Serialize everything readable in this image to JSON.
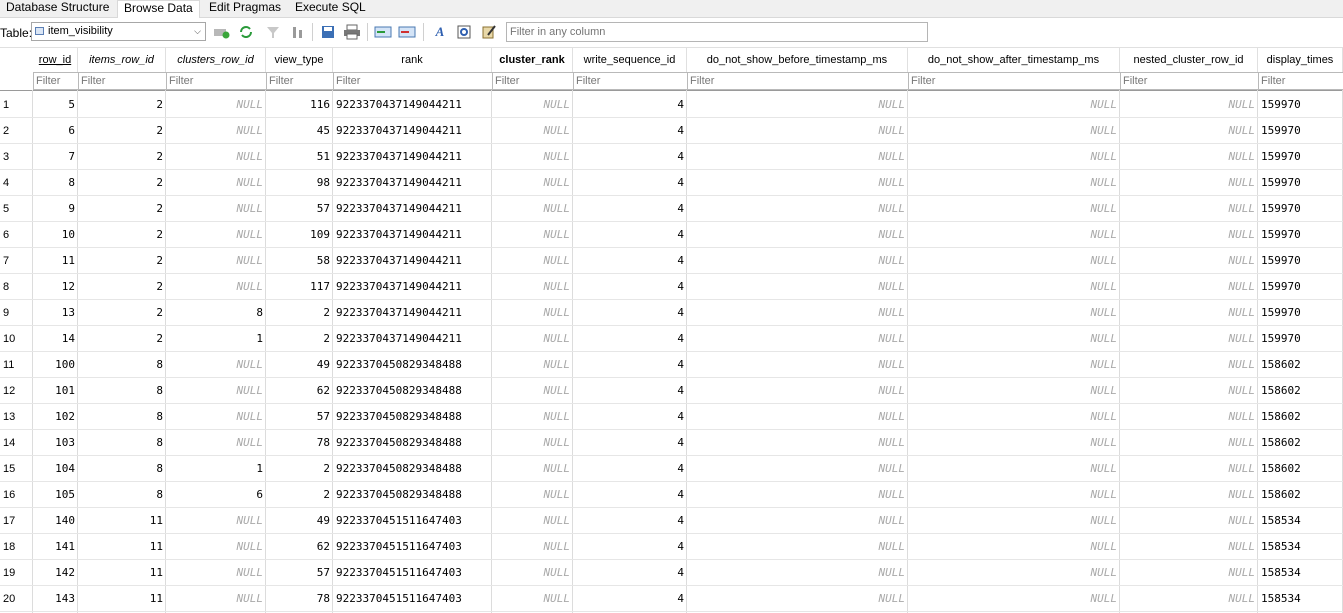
{
  "tabs": [
    {
      "label": "Database Structure"
    },
    {
      "label": "Browse Data"
    },
    {
      "label": "Edit Pragmas"
    },
    {
      "label": "Execute SQL"
    }
  ],
  "toolbar": {
    "table_label": "Table:",
    "table_value": "item_visibility",
    "filter_placeholder": "Filter in any column"
  },
  "columns": [
    "row_id",
    "items_row_id",
    "clusters_row_id",
    "view_type",
    "rank",
    "cluster_rank",
    "write_sequence_id",
    "do_not_show_before_timestamp_ms",
    "do_not_show_after_timestamp_ms",
    "nested_cluster_row_id",
    "display_times"
  ],
  "filter_placeholder": "Filter",
  "null_text": "NULL",
  "rows": [
    {
      "n": "1",
      "c": [
        "5",
        "2",
        null,
        "116",
        "9223370437149044211",
        null,
        "4",
        null,
        null,
        null,
        "159970"
      ]
    },
    {
      "n": "2",
      "c": [
        "6",
        "2",
        null,
        "45",
        "9223370437149044211",
        null,
        "4",
        null,
        null,
        null,
        "159970"
      ]
    },
    {
      "n": "3",
      "c": [
        "7",
        "2",
        null,
        "51",
        "9223370437149044211",
        null,
        "4",
        null,
        null,
        null,
        "159970"
      ]
    },
    {
      "n": "4",
      "c": [
        "8",
        "2",
        null,
        "98",
        "9223370437149044211",
        null,
        "4",
        null,
        null,
        null,
        "159970"
      ]
    },
    {
      "n": "5",
      "c": [
        "9",
        "2",
        null,
        "57",
        "9223370437149044211",
        null,
        "4",
        null,
        null,
        null,
        "159970"
      ]
    },
    {
      "n": "6",
      "c": [
        "10",
        "2",
        null,
        "109",
        "9223370437149044211",
        null,
        "4",
        null,
        null,
        null,
        "159970"
      ]
    },
    {
      "n": "7",
      "c": [
        "11",
        "2",
        null,
        "58",
        "9223370437149044211",
        null,
        "4",
        null,
        null,
        null,
        "159970"
      ]
    },
    {
      "n": "8",
      "c": [
        "12",
        "2",
        null,
        "117",
        "9223370437149044211",
        null,
        "4",
        null,
        null,
        null,
        "159970"
      ]
    },
    {
      "n": "9",
      "c": [
        "13",
        "2",
        "8",
        "2",
        "9223370437149044211",
        null,
        "4",
        null,
        null,
        null,
        "159970"
      ]
    },
    {
      "n": "10",
      "c": [
        "14",
        "2",
        "1",
        "2",
        "9223370437149044211",
        null,
        "4",
        null,
        null,
        null,
        "159970"
      ]
    },
    {
      "n": "11",
      "c": [
        "100",
        "8",
        null,
        "49",
        "9223370450829348488",
        null,
        "4",
        null,
        null,
        null,
        "158602"
      ]
    },
    {
      "n": "12",
      "c": [
        "101",
        "8",
        null,
        "62",
        "9223370450829348488",
        null,
        "4",
        null,
        null,
        null,
        "158602"
      ]
    },
    {
      "n": "13",
      "c": [
        "102",
        "8",
        null,
        "57",
        "9223370450829348488",
        null,
        "4",
        null,
        null,
        null,
        "158602"
      ]
    },
    {
      "n": "14",
      "c": [
        "103",
        "8",
        null,
        "78",
        "9223370450829348488",
        null,
        "4",
        null,
        null,
        null,
        "158602"
      ]
    },
    {
      "n": "15",
      "c": [
        "104",
        "8",
        "1",
        "2",
        "9223370450829348488",
        null,
        "4",
        null,
        null,
        null,
        "158602"
      ]
    },
    {
      "n": "16",
      "c": [
        "105",
        "8",
        "6",
        "2",
        "9223370450829348488",
        null,
        "4",
        null,
        null,
        null,
        "158602"
      ]
    },
    {
      "n": "17",
      "c": [
        "140",
        "11",
        null,
        "49",
        "9223370451511647403",
        null,
        "4",
        null,
        null,
        null,
        "158534"
      ]
    },
    {
      "n": "18",
      "c": [
        "141",
        "11",
        null,
        "62",
        "9223370451511647403",
        null,
        "4",
        null,
        null,
        null,
        "158534"
      ]
    },
    {
      "n": "19",
      "c": [
        "142",
        "11",
        null,
        "57",
        "9223370451511647403",
        null,
        "4",
        null,
        null,
        null,
        "158534"
      ]
    },
    {
      "n": "20",
      "c": [
        "143",
        "11",
        null,
        "78",
        "9223370451511647403",
        null,
        "4",
        null,
        null,
        null,
        "158534"
      ]
    }
  ]
}
